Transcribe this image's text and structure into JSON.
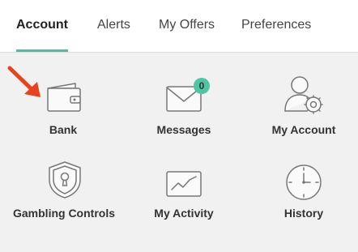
{
  "tabs": [
    {
      "label": "Account",
      "active": true
    },
    {
      "label": "Alerts",
      "active": false
    },
    {
      "label": "My Offers",
      "active": false
    },
    {
      "label": "Preferences",
      "active": false
    }
  ],
  "tiles": [
    {
      "label": "Bank",
      "icon": "wallet-icon"
    },
    {
      "label": "Messages",
      "icon": "envelope-icon",
      "badge": "0"
    },
    {
      "label": "My Account",
      "icon": "user-settings-icon"
    },
    {
      "label": "Gambling Controls",
      "icon": "shield-lock-icon"
    },
    {
      "label": "My Activity",
      "icon": "activity-chart-icon"
    },
    {
      "label": "History",
      "icon": "clock-icon"
    }
  ],
  "colors": {
    "accent": "#47c1a4",
    "badge": "#4ec6a3",
    "arrow": "#e8431c",
    "background": "#f1f1f1"
  }
}
